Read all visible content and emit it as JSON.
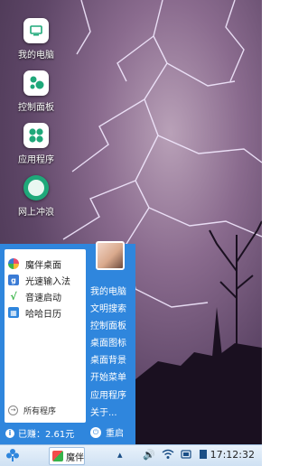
{
  "desktop": {
    "icons": [
      {
        "label": "我的电脑",
        "icon": "computer-icon"
      },
      {
        "label": "控制面板",
        "icon": "control-panel-icon"
      },
      {
        "label": "应用程序",
        "icon": "apps-icon"
      },
      {
        "label": "网上冲浪",
        "icon": "browser-icon"
      }
    ]
  },
  "start_menu": {
    "apps": [
      {
        "label": "魔伴桌面",
        "icon": "mobandesk-icon",
        "color": "#e84d6f"
      },
      {
        "label": "光速输入法",
        "icon": "input-method-icon",
        "color": "#3a7bd5"
      },
      {
        "label": "音速启动",
        "icon": "launcher-icon",
        "color": "#3bb54a"
      },
      {
        "label": "哈哈日历",
        "icon": "calendar-icon",
        "color": "#2f86dd"
      }
    ],
    "all_programs": "所有程序",
    "earned": "已赚：2.61元",
    "right_items": [
      "我的电脑",
      "文明搜索",
      "控制面板",
      "桌面图标",
      "桌面背景",
      "开始菜单",
      "应用程序",
      "关于..."
    ],
    "restart": "重启",
    "accent": "#2f86dd"
  },
  "taskbar": {
    "task_label": "魔伴",
    "clock": "17:12:32",
    "tray_icons": [
      "chevron-up-icon",
      "volume-icon",
      "wifi-icon",
      "battery-icon",
      "screen-icon"
    ]
  }
}
